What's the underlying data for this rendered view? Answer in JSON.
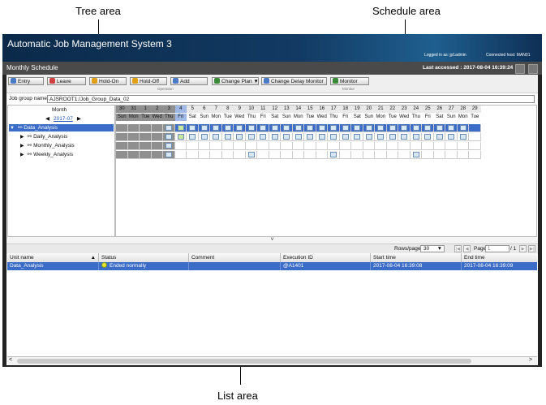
{
  "callouts": {
    "tree": "Tree area",
    "schedule": "Schedule area",
    "list": "List area"
  },
  "app": {
    "title": "Automatic Job Management System 3",
    "logged_in": "Logged in as: jp1admin",
    "connected_host": "Connected host: MAN01",
    "screen_title": "Monthly Schedule",
    "last_accessed": "Last accessed : 2017-08-04 16:39:24"
  },
  "toolbar": {
    "buttons": [
      {
        "label": "Entry",
        "icon": "entry-icon",
        "color": "#4a7bc4"
      },
      {
        "label": "Leave",
        "icon": "leave-icon",
        "color": "#d04040"
      },
      {
        "label": "Hold-On",
        "icon": "hold-on-icon",
        "color": "#e0a010"
      },
      {
        "label": "Hold-Off",
        "icon": "hold-off-icon",
        "color": "#e0a010"
      },
      {
        "label": "Add",
        "icon": "add-icon",
        "color": "#4a7bc4"
      },
      {
        "label": "Change Plan",
        "icon": "change-plan-icon",
        "color": "#3a8a3a"
      },
      {
        "label": "Change Delay Monitor",
        "icon": "delay-monitor-icon",
        "color": "#4a7bc4"
      },
      {
        "label": "Monitor",
        "icon": "monitor-icon",
        "color": "#3a8a3a"
      }
    ],
    "group_operation": "Operation",
    "group_monitor": "Monitor"
  },
  "job_group": {
    "label": "Job group name:",
    "value": "AJSROOT1:/Job_Group_Data_02"
  },
  "tree": {
    "month_label": "Month",
    "month_value": "2017-07",
    "items": [
      {
        "label": "Data_Analysis",
        "selected": true,
        "expander": "▼"
      },
      {
        "label": "Daily_Analysis",
        "selected": false,
        "expander": "▶"
      },
      {
        "label": "Monthly_Analysis",
        "selected": false,
        "expander": "▶"
      },
      {
        "label": "Weekly_Analysis",
        "selected": false,
        "expander": "▶"
      }
    ]
  },
  "schedule": {
    "days": [
      {
        "d": "30",
        "w": "Sun",
        "k": "past"
      },
      {
        "d": "31",
        "w": "Mon",
        "k": "past"
      },
      {
        "d": "1",
        "w": "Tue",
        "k": "past"
      },
      {
        "d": "2",
        "w": "Wed",
        "k": "past"
      },
      {
        "d": "3",
        "w": "Thu",
        "k": "past"
      },
      {
        "d": "4",
        "w": "Fri",
        "k": "today"
      },
      {
        "d": "5",
        "w": "Sat",
        "k": "future"
      },
      {
        "d": "6",
        "w": "Sun",
        "k": "future"
      },
      {
        "d": "7",
        "w": "Mon",
        "k": "future"
      },
      {
        "d": "8",
        "w": "Tue",
        "k": "future"
      },
      {
        "d": "9",
        "w": "Wed",
        "k": "future"
      },
      {
        "d": "10",
        "w": "Thu",
        "k": "future"
      },
      {
        "d": "11",
        "w": "Fri",
        "k": "future"
      },
      {
        "d": "12",
        "w": "Sat",
        "k": "future"
      },
      {
        "d": "13",
        "w": "Sun",
        "k": "future"
      },
      {
        "d": "14",
        "w": "Mon",
        "k": "future"
      },
      {
        "d": "15",
        "w": "Tue",
        "k": "future"
      },
      {
        "d": "16",
        "w": "Wed",
        "k": "future"
      },
      {
        "d": "17",
        "w": "Thu",
        "k": "future"
      },
      {
        "d": "18",
        "w": "Fri",
        "k": "future"
      },
      {
        "d": "19",
        "w": "Sat",
        "k": "future"
      },
      {
        "d": "20",
        "w": "Sun",
        "k": "future"
      },
      {
        "d": "21",
        "w": "Mon",
        "k": "future"
      },
      {
        "d": "22",
        "w": "Tue",
        "k": "future"
      },
      {
        "d": "23",
        "w": "Wed",
        "k": "future"
      },
      {
        "d": "24",
        "w": "Thu",
        "k": "future"
      },
      {
        "d": "25",
        "w": "Fri",
        "k": "future"
      },
      {
        "d": "26",
        "w": "Sat",
        "k": "future"
      },
      {
        "d": "27",
        "w": "Sun",
        "k": "future"
      },
      {
        "d": "28",
        "w": "Mon",
        "k": "future"
      },
      {
        "d": "29",
        "w": "Tue",
        "k": "future"
      }
    ],
    "marked": [
      [
        5,
        6,
        7,
        8,
        9,
        10,
        11,
        12,
        13,
        14,
        15,
        16,
        17,
        18,
        19,
        20,
        21,
        22,
        23,
        24,
        25,
        26,
        27,
        28,
        29,
        30
      ],
      [
        5,
        6,
        7,
        8,
        9,
        10,
        11,
        12,
        13,
        14,
        15,
        16,
        17,
        18,
        19,
        20,
        21,
        22,
        23,
        24,
        25,
        26,
        27,
        28,
        29,
        30
      ],
      [
        5
      ],
      [
        5,
        12,
        19,
        26
      ]
    ],
    "colors": {
      "past": "#8f8f8f",
      "today": "#9fb8e6",
      "header": "#e9e9e9",
      "selected_row": "#3a6cc8"
    }
  },
  "pager": {
    "rows_label": "Rows/page:",
    "rows_value": "30",
    "page_label": "Page:",
    "page_value": "1",
    "page_total": "/ 1"
  },
  "list": {
    "columns": [
      "Unit name",
      "Status",
      "Comment",
      "Execution ID",
      "Start time",
      "End time"
    ],
    "rows": [
      {
        "unit": "Data_Analysis",
        "status": "Ended normally",
        "comment": "",
        "exec_id": "@A1401",
        "start": "2017-08-04 16:39:08",
        "end": "2017-08-04 16:39:09"
      }
    ]
  }
}
